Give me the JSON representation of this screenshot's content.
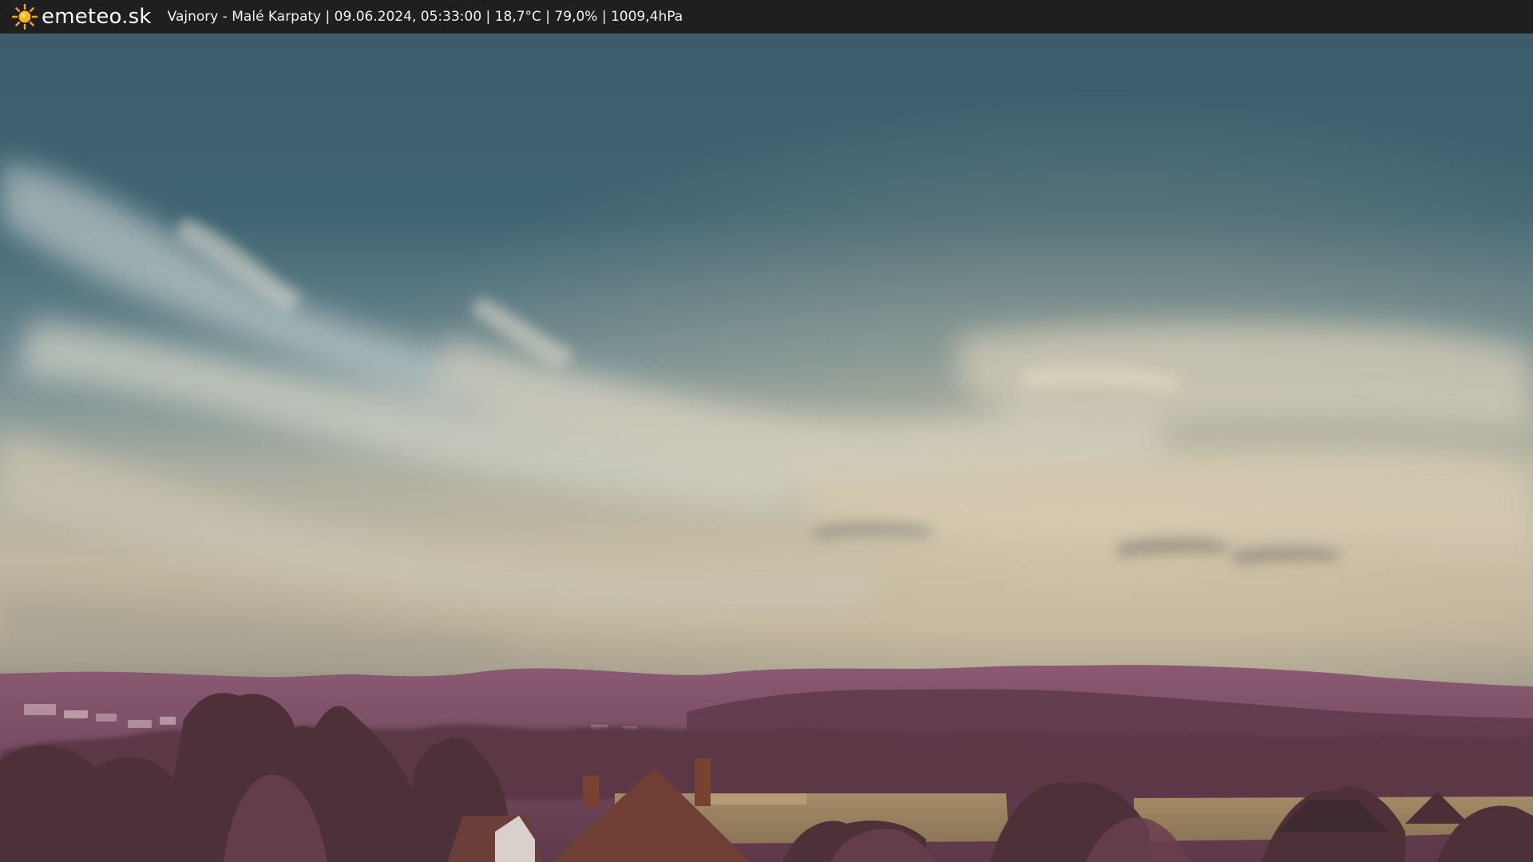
{
  "header": {
    "brand": "emeteo.sk",
    "logo_icon": "sun-icon",
    "location": "Vajnory - Malé Karpaty",
    "datetime": "09.06.2024, 05:33:00",
    "temperature": "18,7°C",
    "humidity": "79,0%",
    "pressure": "1009,4hPa",
    "caption": "Vajnory - Malé Karpaty | 09.06.2024, 05:33:00 | 18,7°C | 79,0% | 1009,4hPa"
  },
  "colors": {
    "bar_background": "#1f1f1f",
    "sky_top": "#3a5a6a",
    "sky_mid": "#8ea2a5",
    "sky_horizon": "#c9bfa8",
    "hills": "#7a4a62",
    "trees": "#5a3a44",
    "field": "#9a8462"
  }
}
